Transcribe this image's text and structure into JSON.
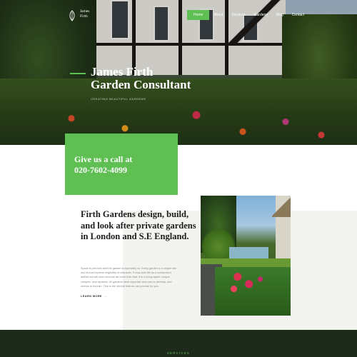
{
  "logo": {
    "line1": "James",
    "line2": "Firth"
  },
  "nav": {
    "items": [
      {
        "label": "Home",
        "active": true
      },
      {
        "label": "About",
        "active": false
      },
      {
        "label": "Services",
        "active": false
      },
      {
        "label": "Gardens",
        "active": false
      },
      {
        "label": "Blog",
        "active": false
      },
      {
        "label": "Contact",
        "active": false
      }
    ]
  },
  "hero": {
    "title_line1": "James Firth",
    "title_line2": "Garden Consultant",
    "subtitle": "CREATING BEAUTIFUL GARDENS"
  },
  "call": {
    "line1": "Give us a call at",
    "line2": "020-7602-4099"
  },
  "about": {
    "title": "Firth Gardens design, build, and look after private gardens in London and S.E England.",
    "body": "Space is precious and the garden is especially so. Every garden is a unique site and should express originality of character. It may start life as a constructed artifact but will soon become far more than that. It is a living space: unique, complex, and dynamic. All gardens need expertise and care to develop, and nurture to flourish. This is the service that we can provide for you.",
    "learn_more": "LEARN MORE"
  },
  "services": {
    "label": "SERVICES"
  },
  "colors": {
    "accent": "#5fbf53",
    "dark": "#1f2b1a"
  }
}
